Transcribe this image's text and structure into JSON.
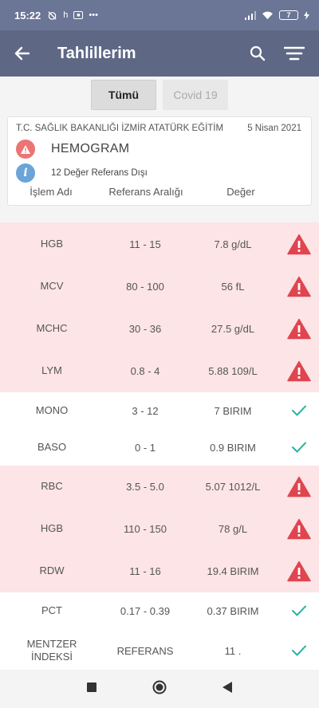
{
  "status_bar": {
    "time": "15:22",
    "battery": "7"
  },
  "app_bar": {
    "title": "Tahlillerim"
  },
  "tabs": [
    {
      "label": "Tümü",
      "active": true
    },
    {
      "label": "Covid 19",
      "active": false
    }
  ],
  "card": {
    "institution": "T.C. SAĞLIK BAKANLIĞI İZMİR ATATÜRK EĞİTİM",
    "date": "5 Nisan 2021",
    "test_name": "HEMOGRAM",
    "out_of_range": "12 Değer Referans Dışı",
    "columns": [
      "İşlem Adı",
      "Referans Aralığı",
      "Değer"
    ]
  },
  "results": [
    {
      "name": "HGB",
      "range": "11 - 15",
      "value": "7.8 g/dL",
      "status": "warning"
    },
    {
      "name": "MCV",
      "range": "80 - 100",
      "value": "56 fL",
      "status": "warning"
    },
    {
      "name": "MCHC",
      "range": "30 - 36",
      "value": "27.5 g/dL",
      "status": "warning"
    },
    {
      "name": "LYM",
      "range": "0.8 - 4",
      "value": "5.88 109/L",
      "status": "warning"
    },
    {
      "name": "MONO",
      "range": "3 - 12",
      "value": "7 BIRIM",
      "status": "ok"
    },
    {
      "name": "BASO",
      "range": "0 - 1",
      "value": "0.9 BIRIM",
      "status": "ok"
    },
    {
      "name": "RBC",
      "range": "3.5 - 5.0",
      "value": "5.07 1012/L",
      "status": "warning"
    },
    {
      "name": "HGB",
      "range": "110 - 150",
      "value": "78 g/L",
      "status": "warning"
    },
    {
      "name": "RDW",
      "range": "11 - 16",
      "value": "19.4 BIRIM",
      "status": "warning"
    },
    {
      "name": "PCT",
      "range": "0.17 - 0.39",
      "value": "0.37 BIRIM",
      "status": "ok"
    },
    {
      "name": "MENTZER İNDEKSİ",
      "range": "REFERANS",
      "value": "11 .",
      "status": "ok"
    }
  ],
  "colors": {
    "header": "#5e6885",
    "status_bar": "#6b7595",
    "warning_row": "#fde4e6",
    "warning_icon": "#e0454f",
    "ok_icon": "#2bb3a0"
  },
  "icons": {
    "back": "arrow-left-icon",
    "search": "search-icon",
    "filter": "filter-icon",
    "warning": "warning-triangle-icon",
    "ok": "checkmark-icon",
    "info": "info-icon"
  }
}
